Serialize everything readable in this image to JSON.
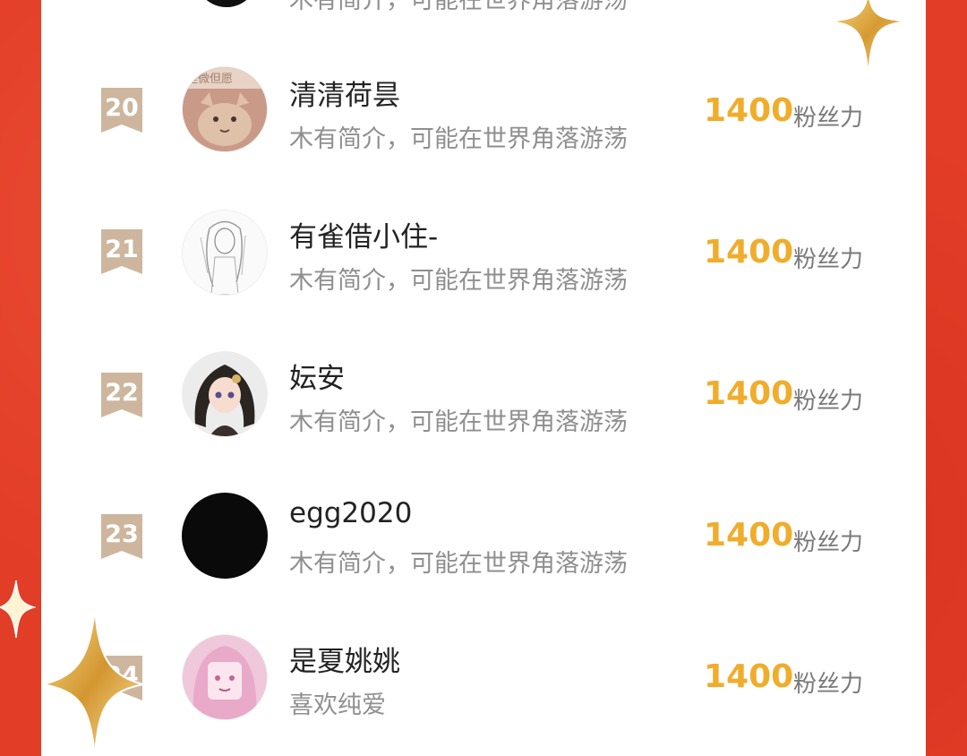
{
  "top_partial_bio": "木有简介，可能在世界角落游荡",
  "score_unit": "粉丝力",
  "rows": [
    {
      "rank": "20",
      "name": "清清荷昙",
      "bio": "木有简介，可能在世界角落游荡",
      "score": "1400",
      "avatar_text": "是微但愿"
    },
    {
      "rank": "21",
      "name": "有雀借小住-",
      "bio": "木有简介，可能在世界角落游荡",
      "score": "1400"
    },
    {
      "rank": "22",
      "name": "妘安",
      "bio": "木有简介，可能在世界角落游荡",
      "score": "1400"
    },
    {
      "rank": "23",
      "name": "egg2020",
      "bio": "木有简介，可能在世界角落游荡",
      "score": "1400"
    },
    {
      "rank": "24",
      "name": "是夏姚姚",
      "bio": "喜欢纯爱",
      "score": "1400"
    }
  ],
  "colors": {
    "background": "#e23d27",
    "score": "#f0ad2c",
    "badge": "#cdb69d"
  }
}
